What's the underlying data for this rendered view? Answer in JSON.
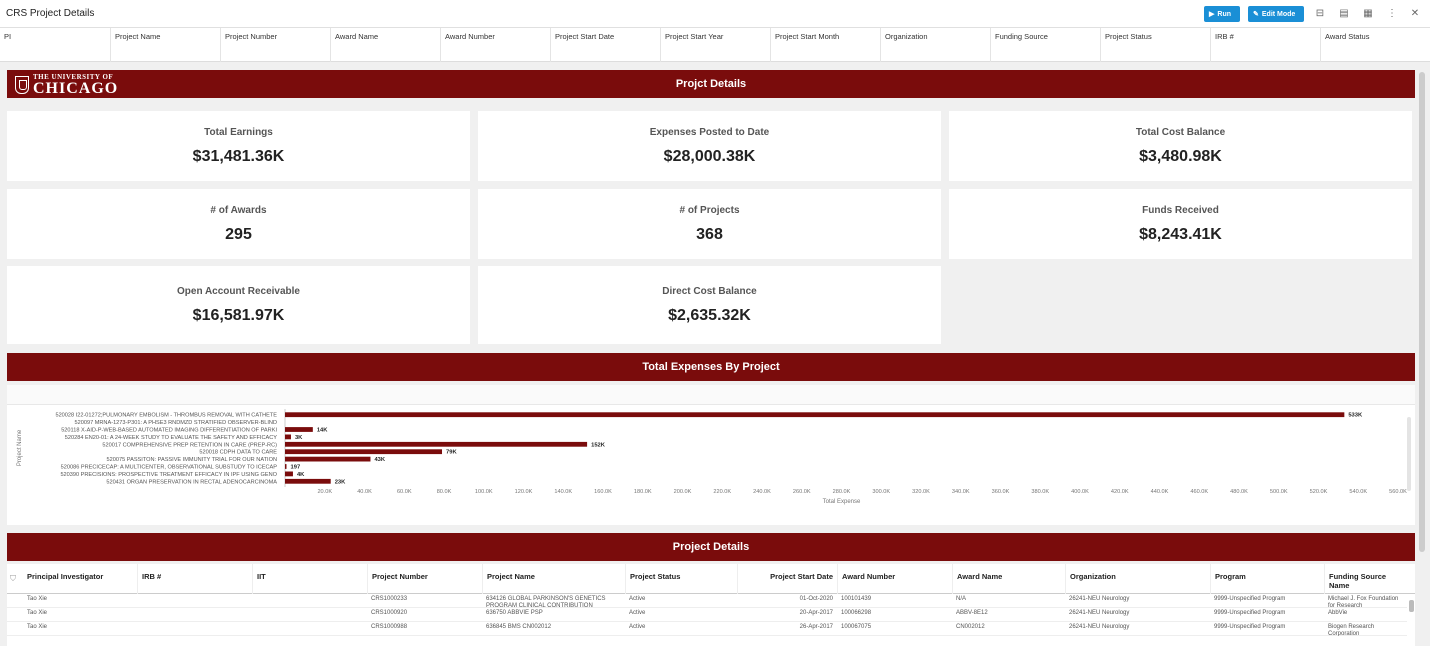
{
  "app": {
    "title": "CRS Project Details",
    "run_label": "Run",
    "edit_label": "Edit Mode"
  },
  "filters": [
    "PI",
    "Project Name",
    "Project Number",
    "Award Name",
    "Award Number",
    "Project Start Date",
    "Project Start Year",
    "Project Start Month",
    "Organization",
    "Funding Source",
    "Project Status",
    "IRB #",
    "Award Status"
  ],
  "logo": {
    "small": "THE UNIVERSITY OF",
    "big": "CHICAGO"
  },
  "banners": {
    "top": "Projct Details",
    "expenses": "Total Expenses By Project",
    "details": "Project Details"
  },
  "kpis": [
    {
      "label": "Total Earnings",
      "value": "$31,481.36K"
    },
    {
      "label": "Expenses Posted to Date",
      "value": "$28,000.38K"
    },
    {
      "label": "Total Cost Balance",
      "value": "$3,480.98K"
    },
    {
      "label": "# of Awards",
      "value": "295"
    },
    {
      "label": "# of Projects",
      "value": "368"
    },
    {
      "label": "Funds Received",
      "value": "$8,243.41K"
    },
    {
      "label": "Open Account Receivable",
      "value": "$16,581.97K"
    },
    {
      "label": "Direct Cost Balance",
      "value": "$2,635.32K"
    }
  ],
  "chart_data": {
    "type": "bar",
    "orientation": "horizontal",
    "ylabel": "Project Name",
    "xlabel": "Total Expense",
    "xlim": [
      0,
      560000
    ],
    "xticks": [
      "20.0K",
      "40.0K",
      "60.0K",
      "80.0K",
      "100.0K",
      "120.0K",
      "140.0K",
      "160.0K",
      "180.0K",
      "200.0K",
      "220.0K",
      "240.0K",
      "260.0K",
      "280.0K",
      "300.0K",
      "320.0K",
      "340.0K",
      "360.0K",
      "380.0K",
      "400.0K",
      "420.0K",
      "440.0K",
      "460.0K",
      "480.0K",
      "500.0K",
      "520.0K",
      "540.0K",
      "560.0K"
    ],
    "categories": [
      "520028 I22-01272;PULMONARY EMBOLISM - THROMBUS REMOVAL WITH CATHETE",
      "520097 MRNA-1273-P301: A PHSE3 RNDMZD STRATIFIED OBSERVER-BLIND",
      "520118 X-AID-P-WEB-BASED AUTOMATED IMAGING DIFFERENTIATION OF PARKI",
      "520284 EN20-01: A 24-WEEK STUDY TO EVALUATE THE SAFETY AND EFFICACY",
      "520017 COMPREHENSIVE PREP RETENTION IN CARE (PREP-RC)",
      "520018 CDPH DATA TO CARE",
      "520075 PASSITON: PASSIVE IMMUNITY TRIAL FOR OUR NATION",
      "520086 PRECICECAP: A MULTICENTER, OBSERVATIONAL SUBSTUDY TO ICECAP",
      "520390 PRECISIONS: PROSPECTIVE TREATMENT EFFICACY IN IPF USING GENO",
      "520431 ORGAN PRESERVATION IN RECTAL ADENOCARCINOMA"
    ],
    "values": [
      533000,
      0,
      14000,
      3000,
      152000,
      79000,
      43000,
      197,
      4000,
      23000
    ],
    "data_labels": [
      "533K",
      "",
      "14K",
      "3K",
      "152K",
      "79K",
      "43K",
      "197",
      "4K",
      "23K"
    ],
    "color": "#7a0c0c"
  },
  "table": {
    "columns": [
      "Principal Investigator",
      "IRB #",
      "IIT",
      "Project Number",
      "Project Name",
      "Project Status",
      "Project Start Date",
      "Award Number",
      "Award Name",
      "Organization",
      "Program",
      "Funding Source Name"
    ],
    "rows": [
      [
        "Tao Xie",
        "",
        "",
        "CRS1000233",
        "634126 GLOBAL PARKINSON'S GENETICS PROGRAM CLINICAL CONTRIBUTION",
        "Active",
        "01-Oct-2020",
        "100101439",
        "N/A",
        "26241-NEU Neurology",
        "9999-Unspecified Program",
        "Michael J. Fox Foundation for Research"
      ],
      [
        "Tao Xie",
        "",
        "",
        "CRS1000920",
        "636750 ABBVIE PSP",
        "Active",
        "20-Apr-2017",
        "100066298",
        "ABBV-8E12",
        "26241-NEU Neurology",
        "9999-Unspecified Program",
        "AbbVie"
      ],
      [
        "Tao Xie",
        "",
        "",
        "CRS1000988",
        "636845 BMS CN002012",
        "Active",
        "26-Apr-2017",
        "100067075",
        "CN002012",
        "26241-NEU Neurology",
        "9999-Unspecified Program",
        "Biogen Research Corporation"
      ]
    ]
  }
}
